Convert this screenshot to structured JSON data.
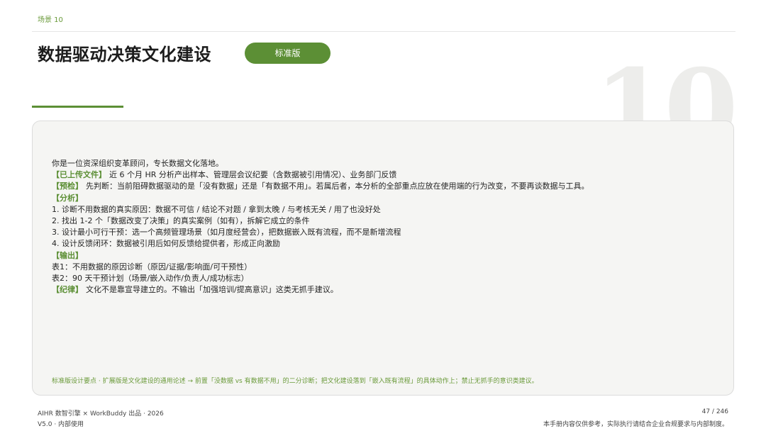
{
  "header": {
    "scene_label": "场景 10",
    "title": "数据驱动决策文化建设",
    "edition_badge": "标准版",
    "scene_number": "10"
  },
  "prompt": {
    "intro": "你是一位资深组织变革顾问，专长数据文化落地。",
    "uploaded_tag": "【已上传文件】",
    "uploaded_text": "近 6 个月 HR 分析产出样本、管理层会议纪要（含数据被引用情况）、业务部门反馈",
    "precheck_tag": "【预检】",
    "precheck_text": "先判断：当前阻碍数据驱动的是「没有数据」还是「有数据不用」。若属后者，本分析的全部重点应放在使用端的行为改变，不要再谈数据与工具。",
    "analysis_tag": "【分析】",
    "analysis_items": [
      "1. 诊断不用数据的真实原因：数据不可信 / 结论不对题 / 拿到太晚 / 与考核无关 / 用了也没好处",
      "2. 找出 1-2 个「数据改变了决策」的真实案例（如有），拆解它成立的条件",
      "3. 设计最小可行干预：选一个高频管理场景（如月度经营会），把数据嵌入既有流程，而不是新增流程",
      "4. 设计反馈闭环：数据被引用后如何反馈给提供者，形成正向激励"
    ],
    "output_tag": "【输出】",
    "output_items": [
      "表1：不用数据的原因诊断（原因/证据/影响面/可干预性）",
      "表2：90 天干预计划（场景/嵌入动作/负责人/成功标志）"
    ],
    "discipline_tag": "【纪律】",
    "discipline_text": "文化不是靠宣导建立的。不输出「加强培训/提高意识」这类无抓手建议。"
  },
  "card_note": "标准版设计要点 · 扩展版是文化建设的通用论述 → 前置「没数据 vs 有数据不用」的二分诊断；把文化建设落到「嵌入既有流程」的具体动作上；禁止无抓手的意识类建议。",
  "footer": {
    "left_line1": "AIHR 数智引擎 × WorkBuddy 出品 · 2026",
    "left_line2": "V5.0 · 内部使用",
    "page_number": "47 / 246",
    "disclaimer": "本手册内容仅供参考，实际执行请结合企业合规要求与内部制度。"
  },
  "colors": {
    "accent_green": "#5c8f35",
    "card_background": "#f5f5f3",
    "watermark_number": "#ededeb"
  }
}
